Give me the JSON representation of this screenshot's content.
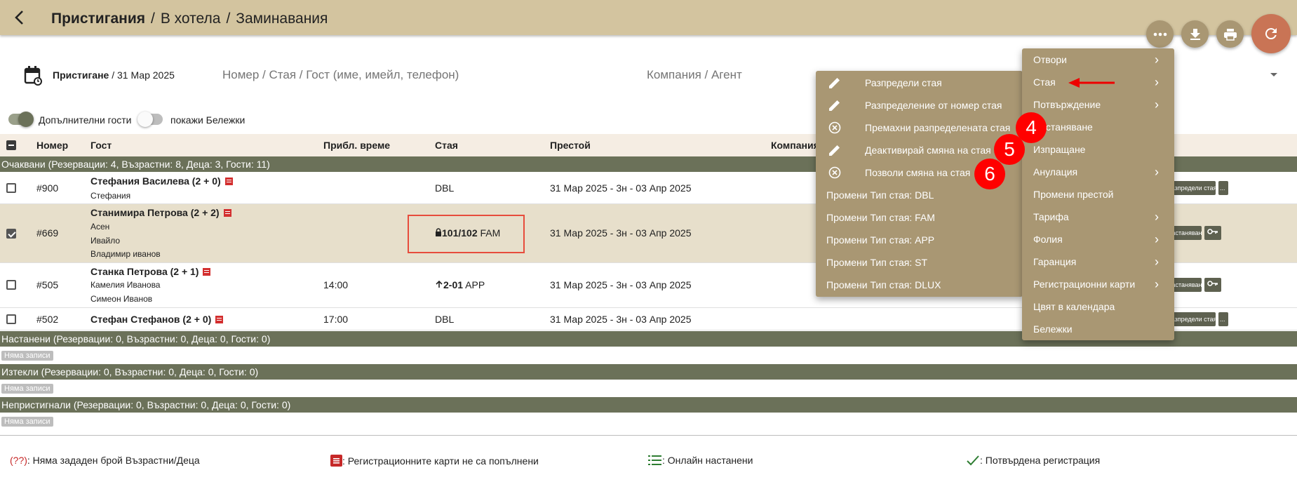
{
  "header": {
    "crumb_1": "Пристигания",
    "crumb_2": "В хотела",
    "crumb_3": "Заминавания",
    "sep": "/",
    "colors": {
      "bar": "#d3c49f",
      "fab": "#a99773",
      "refresh": "#c97455"
    }
  },
  "filter": {
    "date_label": "Пристигане",
    "date_value": "/ 31 Мар 2025",
    "search_placeholder": "Номер / Стая / Гост (име, имейл, телефон)",
    "company_placeholder": "Компания / Агент"
  },
  "toggles": {
    "extra_guests": "Допълнителни гости",
    "show_notes": "покажи Бележки"
  },
  "table": {
    "headers": {
      "number": "Номер",
      "guest": "Гост",
      "time": "Прибл. време",
      "room": "Стая",
      "stay": "Престой",
      "company": "Компания"
    },
    "groups": {
      "expected": "Очаквани (Резервации: 4, Възрастни: 8, Деца: 3, Гости: 11)",
      "checked_in": "Настанени (Резервации: 0, Възрастни: 0, Деца: 0, Гости: 0)",
      "expired": "Изтекли (Резервации: 0, Възрастни: 0, Деца: 0, Гости: 0)",
      "no_show": "Непристигнали (Резервации: 0, Възрастни: 0, Деца: 0, Гости: 0)"
    },
    "no_records": "Няма записи",
    "rows": [
      {
        "number": "#900",
        "guest": "Стефания Василева (2 + 0)",
        "subs": [
          "Стефания"
        ],
        "time": "",
        "room_bold": "",
        "room_type": "DBL",
        "stay": "31 Мар 2025 - 3н - 03 Апр 2025",
        "action": "Разпредели стая",
        "more": "...",
        "checked": false
      },
      {
        "number": "#669",
        "guest": "Станимира Петрова (2 + 2)",
        "subs": [
          "Асен",
          "Ивайло",
          "Владимир иванов"
        ],
        "time": "",
        "room_bold": "101/102",
        "room_type": "FAM",
        "stay": "31 Мар 2025 - 3н - 03 Апр 2025",
        "action": "Настаняване",
        "checked": true
      },
      {
        "number": "#505",
        "guest": "Станка Петрова (2 + 1)",
        "subs": [
          "Камелия Иванова",
          "Симеон Иванов"
        ],
        "time": "14:00",
        "room_bold": "2-01",
        "room_type": "APP",
        "stay": "31 Мар 2025 - 3н - 03 Апр 2025",
        "action": "Настаняване",
        "checked": false
      },
      {
        "number": "#502",
        "guest": "Стефан Стефанов (2 + 0)",
        "subs": [],
        "time": "17:00",
        "room_bold": "",
        "room_type": "DBL",
        "stay": "31 Мар 2025 - 3н - 03 Апр 2025",
        "action": "Разпредели стая",
        "more": "...",
        "checked": false
      }
    ]
  },
  "main_menu": {
    "items": [
      "Отвори",
      "Стая",
      "Потвърждение",
      "Настаняване",
      "Изпращане",
      "Анулация",
      "Промени престой",
      "Тарифа",
      "Фолия",
      "Гаранция",
      "Регистрационни карти",
      "Цвят в календара",
      "Бележки"
    ],
    "has_submenu": [
      true,
      true,
      true,
      false,
      false,
      true,
      false,
      true,
      true,
      true,
      true,
      false,
      false
    ]
  },
  "room_submenu": {
    "items": [
      "Разпредели стая",
      "Разпределение от номер стая",
      "Премахни разпределената стая",
      "Деактивирай смяна на стая",
      "Позволи смяна на стая"
    ],
    "icons": [
      "pencil-icon",
      "pencil-icon",
      "cancel-circle-icon",
      "pencil-icon",
      "cancel-circle-icon"
    ],
    "types": [
      "Промени Тип стая: DBL",
      "Промени Тип стая: FAM",
      "Промени Тип стая: APP",
      "Промени Тип стая: ST",
      "Промени Тип стая: DLUX"
    ]
  },
  "badges": [
    "4",
    "5",
    "6"
  ],
  "legend": {
    "q_mark": "(??)",
    "q_text": ": Няма зададен брой Възрастни/Деца",
    "reg_text": ": Регистрационните карти не са попълнени",
    "online_text": ": Онлайн настанени",
    "confirmed_text": ": Потвърдена регистрация"
  }
}
